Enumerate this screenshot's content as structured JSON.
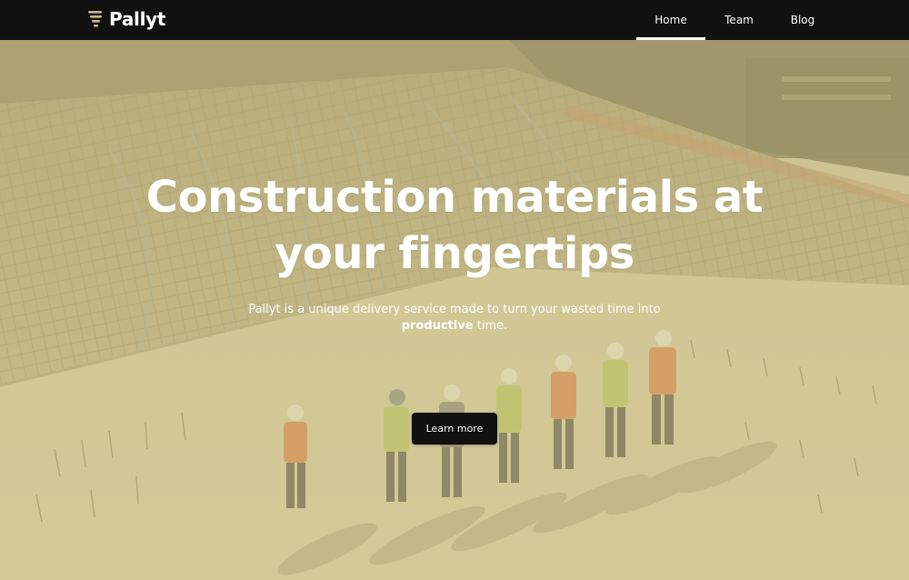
{
  "brand": {
    "name": "Pallyt",
    "logo_icon": "pallet-stack-icon",
    "logo_accent_color": "#c9b68a"
  },
  "nav": {
    "items": [
      {
        "label": "Home",
        "active": true
      },
      {
        "label": "Team",
        "active": false
      },
      {
        "label": "Blog",
        "active": false
      }
    ]
  },
  "hero": {
    "title_line1": "Construction materials at",
    "title_line2": "your fingertips",
    "subtitle_part1": "Pallyt is a unique delivery service made to turn your wasted time into ",
    "subtitle_bold": "productive",
    "subtitle_part2": " time.",
    "cta_label": "Learn more",
    "background": "construction-site-workers-photo"
  },
  "colors": {
    "header_bg": "#111111",
    "hero_tint": "#cec48c",
    "cta_bg": "#111111",
    "text": "#ffffff"
  }
}
